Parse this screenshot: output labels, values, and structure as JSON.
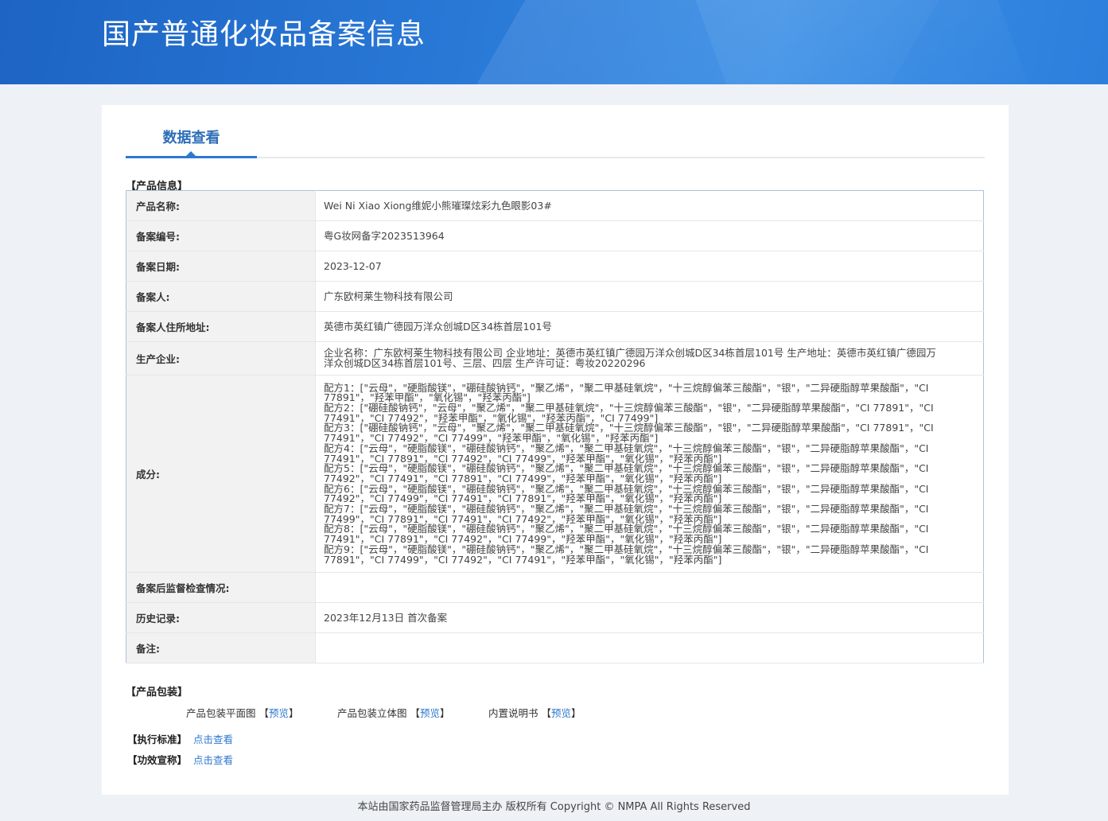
{
  "banner": {
    "title": "国产普通化妆品备案信息"
  },
  "tabs": [
    {
      "label": "数据查看"
    }
  ],
  "product_info": {
    "section_label": "【产品信息】",
    "rows": {
      "name": {
        "key": "产品名称:",
        "value": "Wei Ni Xiao Xiong维妮小熊璀璨炫彩九色眼影03#"
      },
      "reg_no": {
        "key": "备案编号:",
        "value": "粤G妆网备字2023513964"
      },
      "reg_date": {
        "key": "备案日期:",
        "value": "2023-12-07"
      },
      "registrant": {
        "key": "备案人:",
        "value": "广东欧柯莱生物科技有限公司"
      },
      "address": {
        "key": "备案人住所地址:",
        "value": "英德市英红镇广德园万洋众创城D区34栋首层101号"
      },
      "manufacturer": {
        "key": "生产企业:",
        "lines": [
          "企业名称：广东欧柯莱生物科技有限公司 企业地址：英德市英红镇广德园万洋众创城D区34栋首层101号 生产地址：英德市英红镇广德园万",
          "洋众创城D区34栋首层101号、三层、四层 生产许可证：粤妆20220296"
        ]
      },
      "ingredients": {
        "key": "成分:",
        "lines": [
          "配方1：[\"云母\"，\"硬脂酸镁\"，\"硼硅酸钠钙\"，\"聚乙烯\"，\"聚二甲基硅氧烷\"，\"十三烷醇偏苯三酸酯\"，\"银\"，\"二异硬脂醇苹果酸酯\"，\"CI",
          "77891\"，\"羟苯甲酯\"，\"氧化锡\"，\"羟苯丙酯\"]",
          "配方2：[\"硼硅酸钠钙\"，\"云母\"，\"聚乙烯\"，\"聚二甲基硅氧烷\"，\"十三烷醇偏苯三酸酯\"，\"银\"，\"二异硬脂醇苹果酸酯\"，\"CI 77891\"，\"CI",
          "77491\"，\"CI 77492\"，\"羟苯甲酯\"，\"氧化锡\"，\"羟苯丙酯\"，\"CI 77499\"]",
          "配方3：[\"硼硅酸钠钙\"，\"云母\"，\"聚乙烯\"，\"聚二甲基硅氧烷\"，\"十三烷醇偏苯三酸酯\"，\"银\"，\"二异硬脂醇苹果酸酯\"，\"CI 77891\"，\"CI",
          "77491\"，\"CI 77492\"，\"CI 77499\"，\"羟苯甲酯\"，\"氧化锡\"，\"羟苯丙酯\"]",
          "配方4：[\"云母\"，\"硬脂酸镁\"，\"硼硅酸钠钙\"，\"聚乙烯\"，\"聚二甲基硅氧烷\"，\"十三烷醇偏苯三酸酯\"，\"银\"，\"二异硬脂醇苹果酸酯\"，\"CI",
          "77491\"，\"CI 77891\"，\"CI 77492\"，\"CI 77499\"，\"羟苯甲酯\"，\"氧化锡\"，\"羟苯丙酯\"]",
          "配方5：[\"云母\"，\"硬脂酸镁\"，\"硼硅酸钠钙\"，\"聚乙烯\"，\"聚二甲基硅氧烷\"，\"十三烷醇偏苯三酸酯\"，\"银\"，\"二异硬脂醇苹果酸酯\"，\"CI",
          "77492\"，\"CI 77491\"，\"CI 77891\"，\"CI 77499\"，\"羟苯甲酯\"，\"氧化锡\"，\"羟苯丙酯\"]",
          "配方6：[\"云母\"，\"硬脂酸镁\"，\"硼硅酸钠钙\"，\"聚乙烯\"，\"聚二甲基硅氧烷\"，\"十三烷醇偏苯三酸酯\"，\"银\"，\"二异硬脂醇苹果酸酯\"，\"CI",
          "77492\"，\"CI 77499\"，\"CI 77491\"，\"CI 77891\"，\"羟苯甲酯\"，\"氧化锡\"，\"羟苯丙酯\"]",
          "配方7：[\"云母\"，\"硬脂酸镁\"，\"硼硅酸钠钙\"，\"聚乙烯\"，\"聚二甲基硅氧烷\"，\"十三烷醇偏苯三酸酯\"，\"银\"，\"二异硬脂醇苹果酸酯\"，\"CI",
          "77499\"，\"CI 77891\"，\"CI 77491\"，\"CI 77492\"，\"羟苯甲酯\"，\"氧化锡\"，\"羟苯丙酯\"]",
          "配方8：[\"云母\"，\"硬脂酸镁\"，\"硼硅酸钠钙\"，\"聚乙烯\"，\"聚二甲基硅氧烷\"，\"十三烷醇偏苯三酸酯\"，\"银\"，\"二异硬脂醇苹果酸酯\"，\"CI",
          "77491\"，\"CI 77891\"，\"CI 77492\"，\"CI 77499\"，\"羟苯甲酯\"，\"氧化锡\"，\"羟苯丙酯\"]",
          "配方9：[\"云母\"，\"硬脂酸镁\"，\"硼硅酸钠钙\"，\"聚乙烯\"，\"聚二甲基硅氧烷\"，\"十三烷醇偏苯三酸酯\"，\"银\"，\"二异硬脂醇苹果酸酯\"，\"CI",
          "77891\"，\"CI 77499\"，\"CI 77492\"，\"CI 77491\"，\"羟苯甲酯\"，\"氧化锡\"，\"羟苯丙酯\"]"
        ]
      },
      "inspection": {
        "key": "备案后监督检查情况:",
        "value": ""
      },
      "history": {
        "key": "历史记录:",
        "value": "2023年12月13日 首次备案"
      },
      "remarks": {
        "key": "备注:",
        "value": ""
      }
    }
  },
  "packaging": {
    "section_label": "【产品包装】",
    "items": [
      {
        "label": "产品包装平面图",
        "bracket_open": "【",
        "link": "预览",
        "bracket_close": "】"
      },
      {
        "label": "产品包装立体图",
        "bracket_open": "【",
        "link": "预览",
        "bracket_close": "】"
      },
      {
        "label": "内置说明书",
        "bracket_open": "【",
        "link": "预览",
        "bracket_close": "】"
      }
    ]
  },
  "standards": {
    "label": "【执行标准】",
    "link": "点击查看"
  },
  "claims": {
    "label": "【功效宣称】",
    "link": "点击查看"
  },
  "footer": {
    "text": "本站由国家药品监督管理局主办 版权所有 Copyright © NMPA All Rights Reserved"
  },
  "colors": {
    "banner": "#2a7ad8",
    "accent": "#2d79cf",
    "key_cell_bg": "#f2f2f2",
    "page_bg": "#eef2f6"
  }
}
